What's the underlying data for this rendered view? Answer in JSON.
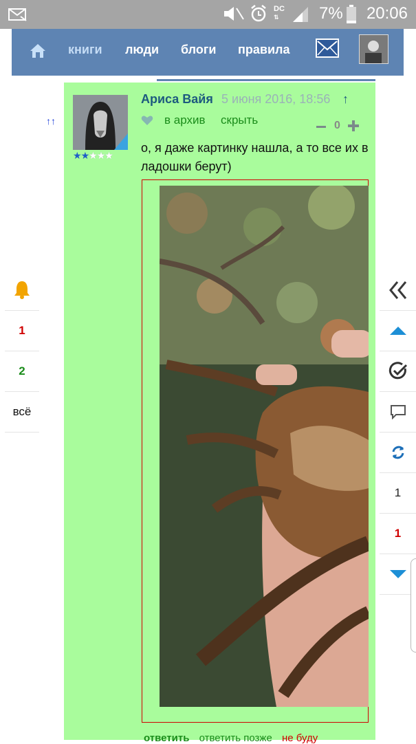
{
  "status_bar": {
    "time": "20:06",
    "battery": "7%",
    "network_label": "DC"
  },
  "nav": {
    "items": [
      {
        "label": "книги"
      },
      {
        "label": "люди"
      },
      {
        "label": "блоги"
      },
      {
        "label": "правила"
      }
    ]
  },
  "left_panel": {
    "items": [
      "1",
      "2",
      "всё"
    ]
  },
  "comment": {
    "up_arrows": "↑↑",
    "author": "Ариса Вайя",
    "date": "5 июня 2016, 18:56",
    "up_link": "↑",
    "archive": "в архив",
    "hide": "скрыть",
    "score": "0",
    "text": "о, я даже картинку нашла, а то все их в ладошки берут)",
    "rating_stars": 2,
    "rating_max": 5,
    "actions": {
      "reply": "ответить",
      "reply_later": "ответить позже",
      "wont": "не буду"
    }
  },
  "right_panel": {
    "counts": [
      "1",
      "1"
    ]
  },
  "colors": {
    "nav_bg": "#5e84b3",
    "comment_bg": "#a9fc9c",
    "link_green": "#1a8c1a",
    "author_blue": "#1d5a7f",
    "alert_red": "#d00000"
  }
}
